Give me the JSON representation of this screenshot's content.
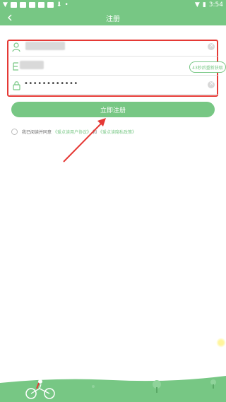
{
  "status_bar": {
    "time": "3:54"
  },
  "app_bar": {
    "title": "注册"
  },
  "form": {
    "password_masked": "••••••••••••",
    "code_button": "43秒后重新获取"
  },
  "submit_button": "立即注册",
  "agreement": {
    "prefix": "我已阅读并同意",
    "user_agreement": "《爱点读用户协议》",
    "and": "和",
    "privacy_policy": "《爱点读隐私政策》"
  },
  "colors": {
    "brand_green": "#77c784",
    "annotation_red": "#e53935"
  }
}
